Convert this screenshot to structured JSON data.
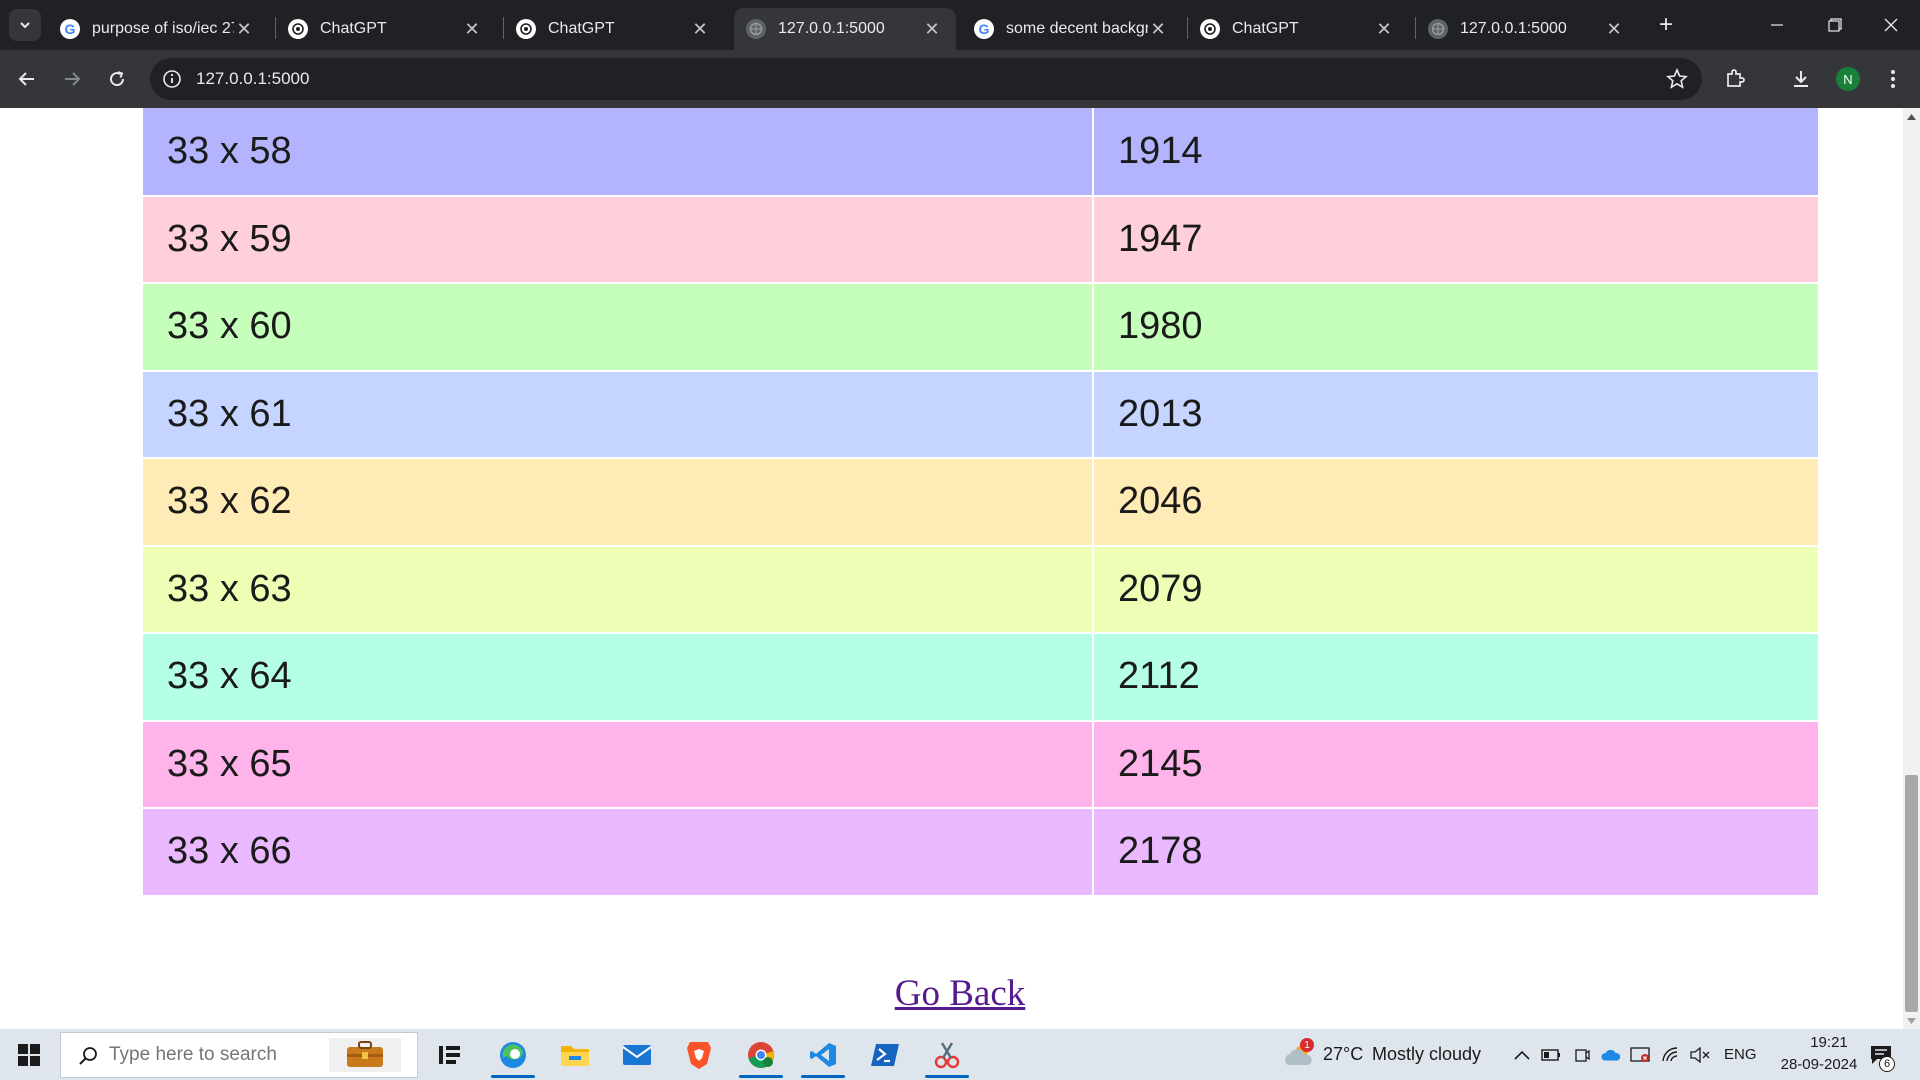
{
  "browser": {
    "tabs": [
      {
        "title": "purpose of iso/iec 27",
        "favicon": "google-icon",
        "active": false
      },
      {
        "title": "ChatGPT",
        "favicon": "chatgpt-icon",
        "active": false
      },
      {
        "title": "ChatGPT",
        "favicon": "chatgpt-icon",
        "active": false
      },
      {
        "title": "127.0.0.1:5000",
        "favicon": "globe-icon",
        "active": true
      },
      {
        "title": "some decent backgro",
        "favicon": "google-icon",
        "active": false
      },
      {
        "title": "ChatGPT",
        "favicon": "chatgpt-icon",
        "active": false
      },
      {
        "title": "127.0.0.1:5000",
        "favicon": "globe-icon",
        "active": false
      }
    ],
    "url": "127.0.0.1:5000",
    "profile_initial": "N"
  },
  "page": {
    "rows": [
      {
        "expr": "33 x 58",
        "result": "1914",
        "color": "#b4b4fe"
      },
      {
        "expr": "33 x 59",
        "result": "1947",
        "color": "#ffd0dc"
      },
      {
        "expr": "33 x 60",
        "result": "1980",
        "color": "#c6ffbb"
      },
      {
        "expr": "33 x 61",
        "result": "2013",
        "color": "#c5d5ff"
      },
      {
        "expr": "33 x 62",
        "result": "2046",
        "color": "#ffebb5"
      },
      {
        "expr": "33 x 63",
        "result": "2079",
        "color": "#ecffb4"
      },
      {
        "expr": "33 x 64",
        "result": "2112",
        "color": "#b4ffe6"
      },
      {
        "expr": "33 x 65",
        "result": "2145",
        "color": "#feb4ea"
      },
      {
        "expr": "33 x 66",
        "result": "2178",
        "color": "#e9b8ff"
      }
    ],
    "go_back_label": "Go Back"
  },
  "taskbar": {
    "search_placeholder": "Type here to search",
    "weather": {
      "temp": "27°C",
      "condition": "Mostly cloudy",
      "badge": "1"
    },
    "language": "ENG",
    "time": "19:21",
    "date": "28-09-2024",
    "notification_count": "6"
  }
}
